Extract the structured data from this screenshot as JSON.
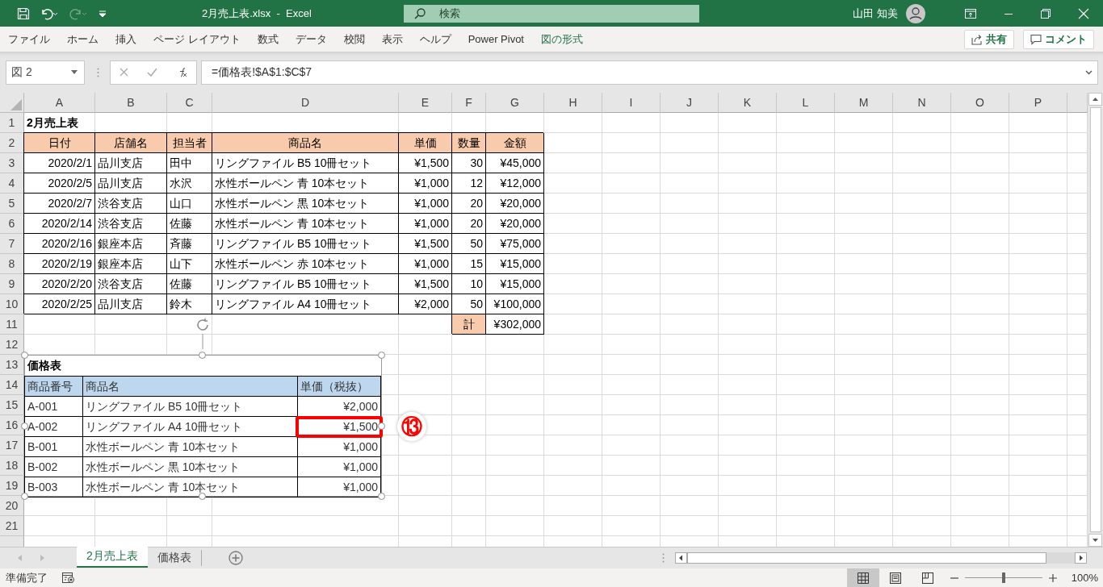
{
  "title_bar": {
    "title": "2月売上表.xlsx  -  Excel",
    "search_placeholder": "検索",
    "user": "山田 知美",
    "redo_disabled": true
  },
  "ribbon_tabs": [
    {
      "label": "ファイル",
      "contextual": false
    },
    {
      "label": "ホーム",
      "contextual": false
    },
    {
      "label": "挿入",
      "contextual": false
    },
    {
      "label": "ページ レイアウト",
      "contextual": false
    },
    {
      "label": "数式",
      "contextual": false
    },
    {
      "label": "データ",
      "contextual": false
    },
    {
      "label": "校閲",
      "contextual": false
    },
    {
      "label": "表示",
      "contextual": false
    },
    {
      "label": "ヘルプ",
      "contextual": false
    },
    {
      "label": "Power Pivot",
      "contextual": false
    },
    {
      "label": "図の形式",
      "contextual": true
    }
  ],
  "share_button": "共有",
  "comment_button": "コメント",
  "formula_bar": {
    "name_box": "図 2",
    "formula": "=価格表!$A$1:$C$7"
  },
  "sheet": {
    "columns": [
      "A",
      "B",
      "C",
      "D",
      "E",
      "F",
      "G",
      "H",
      "I",
      "J",
      "K",
      "L",
      "M",
      "N",
      "O",
      "P"
    ],
    "rows": [
      {
        "number": "1",
        "cells": [
          {
            "text": "2月売上表",
            "kind": "title"
          }
        ]
      },
      {
        "number": "2",
        "cells": [
          {
            "text": "日付",
            "kind": "header"
          },
          {
            "text": "店舗名",
            "kind": "header"
          },
          {
            "text": "担当者",
            "kind": "header"
          },
          {
            "text": "商品名",
            "kind": "header"
          },
          {
            "text": "単価",
            "kind": "header"
          },
          {
            "text": "数量",
            "kind": "header"
          },
          {
            "text": "金額",
            "kind": "header"
          }
        ]
      },
      {
        "number": "3",
        "cells": [
          {
            "text": "2020/2/1",
            "kind": "number"
          },
          {
            "text": "品川支店",
            "kind": "text"
          },
          {
            "text": "田中",
            "kind": "text"
          },
          {
            "text": "リングファイル B5 10冊セット",
            "kind": "text"
          },
          {
            "text": "¥1,500",
            "kind": "number"
          },
          {
            "text": "30",
            "kind": "number"
          },
          {
            "text": "¥45,000",
            "kind": "number"
          }
        ]
      },
      {
        "number": "4",
        "cells": [
          {
            "text": "2020/2/5",
            "kind": "number"
          },
          {
            "text": "品川支店",
            "kind": "text"
          },
          {
            "text": "水沢",
            "kind": "text"
          },
          {
            "text": "水性ボールペン 青 10本セット",
            "kind": "text"
          },
          {
            "text": "¥1,000",
            "kind": "number"
          },
          {
            "text": "12",
            "kind": "number"
          },
          {
            "text": "¥12,000",
            "kind": "number"
          }
        ]
      },
      {
        "number": "5",
        "cells": [
          {
            "text": "2020/2/7",
            "kind": "number"
          },
          {
            "text": "渋谷支店",
            "kind": "text"
          },
          {
            "text": "山口",
            "kind": "text"
          },
          {
            "text": "水性ボールペン 黒 10本セット",
            "kind": "text"
          },
          {
            "text": "¥1,000",
            "kind": "number"
          },
          {
            "text": "20",
            "kind": "number"
          },
          {
            "text": "¥20,000",
            "kind": "number"
          }
        ]
      },
      {
        "number": "6",
        "cells": [
          {
            "text": "2020/2/14",
            "kind": "number"
          },
          {
            "text": "渋谷支店",
            "kind": "text"
          },
          {
            "text": "佐藤",
            "kind": "text"
          },
          {
            "text": "水性ボールペン 青 10本セット",
            "kind": "text"
          },
          {
            "text": "¥1,000",
            "kind": "number"
          },
          {
            "text": "20",
            "kind": "number"
          },
          {
            "text": "¥20,000",
            "kind": "number"
          }
        ]
      },
      {
        "number": "7",
        "cells": [
          {
            "text": "2020/2/16",
            "kind": "number"
          },
          {
            "text": "銀座本店",
            "kind": "text"
          },
          {
            "text": "斉藤",
            "kind": "text"
          },
          {
            "text": "リングファイル B5 10冊セット",
            "kind": "text"
          },
          {
            "text": "¥1,500",
            "kind": "number"
          },
          {
            "text": "50",
            "kind": "number"
          },
          {
            "text": "¥75,000",
            "kind": "number"
          }
        ]
      },
      {
        "number": "8",
        "cells": [
          {
            "text": "2020/2/19",
            "kind": "number"
          },
          {
            "text": "銀座本店",
            "kind": "text"
          },
          {
            "text": "山下",
            "kind": "text"
          },
          {
            "text": "水性ボールペン 赤 10本セット",
            "kind": "text"
          },
          {
            "text": "¥1,000",
            "kind": "number"
          },
          {
            "text": "15",
            "kind": "number"
          },
          {
            "text": "¥15,000",
            "kind": "number"
          }
        ]
      },
      {
        "number": "9",
        "cells": [
          {
            "text": "2020/2/20",
            "kind": "number"
          },
          {
            "text": "渋谷支店",
            "kind": "text"
          },
          {
            "text": "佐藤",
            "kind": "text"
          },
          {
            "text": "リングファイル B5 10冊セット",
            "kind": "text"
          },
          {
            "text": "¥1,500",
            "kind": "number"
          },
          {
            "text": "10",
            "kind": "number"
          },
          {
            "text": "¥15,000",
            "kind": "number"
          }
        ]
      },
      {
        "number": "10",
        "cells": [
          {
            "text": "2020/2/25",
            "kind": "number"
          },
          {
            "text": "品川支店",
            "kind": "text"
          },
          {
            "text": "鈴木",
            "kind": "text"
          },
          {
            "text": "リングファイル A4 10冊セット",
            "kind": "text"
          },
          {
            "text": "¥2,000",
            "kind": "number"
          },
          {
            "text": "50",
            "kind": "number"
          },
          {
            "text": "¥100,000",
            "kind": "number"
          }
        ]
      },
      {
        "number": "11",
        "cells": [
          {
            "kind": "empty"
          },
          {
            "kind": "empty"
          },
          {
            "kind": "empty"
          },
          {
            "kind": "empty"
          },
          {
            "kind": "empty"
          },
          {
            "text": "計",
            "kind": "header"
          },
          {
            "text": "¥302,000",
            "kind": "number"
          }
        ]
      },
      {
        "number": "12"
      },
      {
        "number": "13"
      },
      {
        "number": "14"
      },
      {
        "number": "15"
      },
      {
        "number": "16"
      },
      {
        "number": "17"
      },
      {
        "number": "18"
      },
      {
        "number": "19"
      },
      {
        "number": "20"
      },
      {
        "number": "21"
      }
    ]
  },
  "price_table": {
    "title": "価格表",
    "columns": [
      "商品番号",
      "商品名",
      "単価（税抜）"
    ],
    "rows": [
      {
        "cells": [
          "A-001",
          "リングファイル B5 10冊セット",
          "¥2,000"
        ],
        "highlighted": false
      },
      {
        "cells": [
          "A-002",
          "リングファイル A4 10冊セット",
          "¥1,500"
        ],
        "highlighted": true
      },
      {
        "cells": [
          "B-001",
          "水性ボールペン 青 10本セット",
          "¥1,000"
        ],
        "highlighted": false
      },
      {
        "cells": [
          "B-002",
          "水性ボールペン 黒 10本セット",
          "¥1,000"
        ],
        "highlighted": false
      },
      {
        "cells": [
          "B-003",
          "水性ボールペン 青 10本セット",
          "¥1,000"
        ],
        "highlighted": false
      }
    ],
    "callout": "⑬"
  },
  "sheet_tabs": [
    {
      "label": "2月売上表",
      "selected": true
    },
    {
      "label": "価格表",
      "selected": false
    }
  ],
  "status_bar": {
    "text": "準備完了",
    "views": [
      {
        "kind": "normal",
        "selected": true
      },
      {
        "kind": "page_layout",
        "selected": false
      },
      {
        "kind": "page_break",
        "selected": false
      }
    ],
    "zoom_slider": {
      "level": 0.5
    },
    "zoom": "100%"
  }
}
